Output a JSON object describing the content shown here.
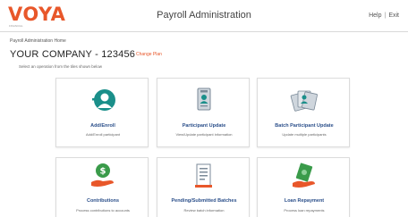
{
  "header": {
    "logo": "VOYA",
    "logo_tag": "FINANCIAL",
    "title": "Payroll Administration",
    "help": "Help",
    "exit": "Exit"
  },
  "breadcrumb": "Payroll Administration Home",
  "company": "YOUR COMPANY - 123456",
  "change_plan": "Change Plan",
  "instructions": "Select an operation from the tiles shown below",
  "tiles": [
    {
      "title": "Add/Enroll",
      "desc": "Add/Enroll participant",
      "icon": "add-person-icon"
    },
    {
      "title": "Participant Update",
      "desc": "View/Update participant information",
      "icon": "id-card-icon"
    },
    {
      "title": "Batch Participant Update",
      "desc": "Update multiple participants",
      "icon": "multiple-cards-icon"
    },
    {
      "title": "Contributions",
      "desc": "Process contributions to accounts",
      "icon": "money-hand-icon"
    },
    {
      "title": "Pending/Submitted Batches",
      "desc": "Review batch information",
      "icon": "document-list-icon"
    },
    {
      "title": "Loan Repayment",
      "desc": "Process loan repayments",
      "icon": "cash-hand-icon"
    }
  ],
  "colors": {
    "brand": "#e8572a",
    "tile_title": "#2b4f8a",
    "icon_teal": "#1a8f8a",
    "icon_green": "#3a9b4a"
  }
}
